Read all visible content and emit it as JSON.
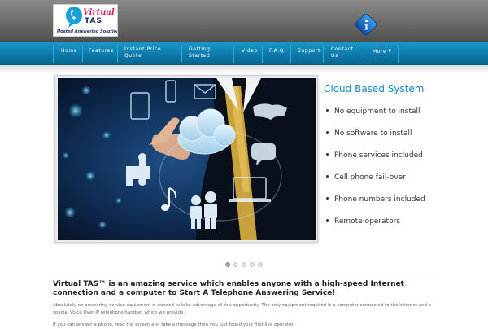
{
  "header": {
    "logo": {
      "word1": "Virtual",
      "word2": "TAS",
      "tagline": "Hosted Answering Solutions"
    },
    "info_icon": "info-icon"
  },
  "nav": {
    "items": [
      {
        "label": "Home"
      },
      {
        "label": "Features"
      },
      {
        "label": "Instant Price",
        "label2": "Quote"
      },
      {
        "label": "Getting",
        "label2": "Started"
      },
      {
        "label": "Video"
      },
      {
        "label": "F.A.Q."
      },
      {
        "label": "Support"
      },
      {
        "label": "Contact",
        "label2": "Us"
      },
      {
        "label": "More",
        "caret": "▼"
      }
    ]
  },
  "slider": {
    "title": "Cloud Based System",
    "features": [
      "No equipment to install",
      "No software to install",
      "Phone services included",
      "Cell phone fail-over",
      "Phone numbers included",
      "Remote operators"
    ],
    "pager_count": 5,
    "active_index": 0
  },
  "intro": {
    "heading": "Virtual TAS™ is an amazing service which enables anyone with a high-speed Internet connection and a computer to Start A Telephone Answering Service!",
    "body": "Absolutely no answering service equipment is needed to take advantage of this opportunity. The only equipment required is a computer connected to the Internet and a special Voice Over IP telephone handset which we provide.",
    "cut_line": "If you can answer a phone, read the screen and take a message then you just found your first live operator."
  },
  "colors": {
    "nav_blue": "#0d79a9",
    "title_blue": "#1b86c4",
    "logo_pink": "#d31f61",
    "logo_navy": "#1d2d64"
  }
}
